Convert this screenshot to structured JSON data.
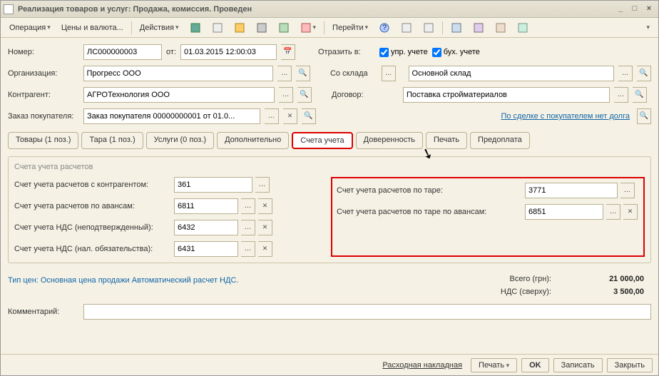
{
  "title": "Реализация товаров и услуг: Продажа, комиссия. Проведен",
  "toolbar": {
    "operation": "Операция",
    "prices": "Цены и валюта...",
    "actions": "Действия",
    "goto": "Перейти"
  },
  "header": {
    "number_lbl": "Номер:",
    "number": "ЛС000000003",
    "from_lbl": "от:",
    "date": "01.03.2015 12:00:03",
    "reflect_lbl": "Отразить в:",
    "upr_chk": "упр. учете",
    "buh_chk": "бух. учете",
    "org_lbl": "Организация:",
    "org": "Прогресс ООО",
    "warehouse_lbl": "Со склада",
    "warehouse": "Основной склад",
    "counter_lbl": "Контрагент:",
    "counter": "АГРОТехнология ООО",
    "contract_lbl": "Договор:",
    "contract": "Поставка стройматериалов",
    "order_lbl": "Заказ покупателя:",
    "order": "Заказ покупателя 00000000001 от 01.0...",
    "deal_link": "По сделке с покупателем нет долга"
  },
  "tabs": {
    "t1": "Товары (1 поз.)",
    "t2": "Тара (1 поз.)",
    "t3": "Услуги (0 поз.)",
    "t4": "Дополнительно",
    "t5": "Счета учета",
    "t6": "Доверенность",
    "t7": "Печать",
    "t8": "Предоплата"
  },
  "accounts": {
    "group_title": "Счета учета расчетов",
    "l1": "Счет учета расчетов с контрагентом:",
    "v1": "361",
    "l2": "Счет учета расчетов по авансам:",
    "v2": "6811",
    "l3": "Счет учета НДС (неподтвержденный):",
    "v3": "6432",
    "l4": "Счет учета НДС (нал. обязательства):",
    "v4": "6431",
    "r1": "Счет учета расчетов по таре:",
    "rv1": "3771",
    "r2": "Счет учета расчетов по таре по авансам:",
    "rv2": "6851"
  },
  "price_type": "Тип цен: Основная цена продажи Автоматический расчет НДС.",
  "totals": {
    "total_lbl": "Всего (грн):",
    "total_val": "21 000,00",
    "vat_lbl": "НДС (сверху):",
    "vat_val": "3 500,00"
  },
  "comment_lbl": "Комментарий:",
  "bottom": {
    "invoice": "Расходная накладная",
    "print": "Печать",
    "ok": "OK",
    "save": "Записать",
    "close": "Закрыть"
  }
}
